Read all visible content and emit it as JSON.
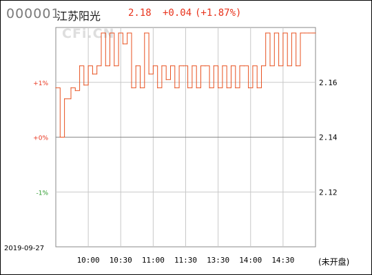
{
  "header": {
    "code": "000001",
    "name": "江苏阳光",
    "price": "2.18",
    "change": "+0.04",
    "change_pct": "(+1.87%)"
  },
  "watermark": "CFi.CN",
  "date": "2019-09-27",
  "status": "(未开盘)",
  "colors": {
    "line": "#e8501f",
    "up": "#e8321b",
    "down": "#2a9a2a",
    "grid": "#c8c8c8",
    "zero": "#888888"
  },
  "chart_data": {
    "type": "line",
    "title": "",
    "xlabel": "",
    "ylabel": "",
    "ylim": [
      2.1,
      2.18
    ],
    "y_ticks_right": [
      "2.16",
      "2.14",
      "2.12"
    ],
    "y_ticks_left": [
      {
        "label": "+1%",
        "color": "up"
      },
      {
        "label": "+0%",
        "color": "up"
      },
      {
        "label": "-1%",
        "color": "down"
      }
    ],
    "x_ticks": [
      "10:00",
      "10:30",
      "11:00",
      "11:30",
      "13:30",
      "14:00",
      "14:30"
    ],
    "grid": true,
    "series": [
      {
        "x": [
          "09:30",
          "09:34",
          "09:38",
          "09:44",
          "09:48",
          "09:52",
          "09:56",
          "10:00",
          "10:04",
          "10:08",
          "10:12",
          "10:16",
          "10:20",
          "10:24",
          "10:28",
          "10:32",
          "10:36",
          "10:40",
          "10:44",
          "10:48",
          "10:52",
          "10:56",
          "11:00",
          "11:04",
          "11:08",
          "11:12",
          "11:16",
          "11:20",
          "11:24",
          "11:28",
          "13:02",
          "13:06",
          "13:10",
          "13:14",
          "13:18",
          "13:22",
          "13:26",
          "13:30",
          "13:34",
          "13:38",
          "13:42",
          "13:46",
          "13:50",
          "13:54",
          "13:58",
          "14:02",
          "14:06",
          "14:10",
          "14:14",
          "14:18",
          "14:22",
          "14:26",
          "14:30",
          "14:34",
          "14:38",
          "14:42",
          "14:46",
          "14:50",
          "14:54",
          "14:58",
          "15:00"
        ],
        "values": [
          2.158,
          2.14,
          2.154,
          2.158,
          2.157,
          2.166,
          2.159,
          2.166,
          2.163,
          2.166,
          2.178,
          2.166,
          2.178,
          2.166,
          2.178,
          2.174,
          2.178,
          2.158,
          2.166,
          2.158,
          2.178,
          2.163,
          2.166,
          2.158,
          2.166,
          2.161,
          2.166,
          2.158,
          2.166,
          2.166,
          2.158,
          2.166,
          2.158,
          2.166,
          2.166,
          2.158,
          2.166,
          2.158,
          2.166,
          2.158,
          2.166,
          2.158,
          2.166,
          2.166,
          2.158,
          2.166,
          2.158,
          2.166,
          2.178,
          2.166,
          2.178,
          2.166,
          2.178,
          2.166,
          2.178,
          2.166,
          2.178,
          2.178,
          2.178,
          2.178,
          2.178
        ]
      }
    ]
  }
}
